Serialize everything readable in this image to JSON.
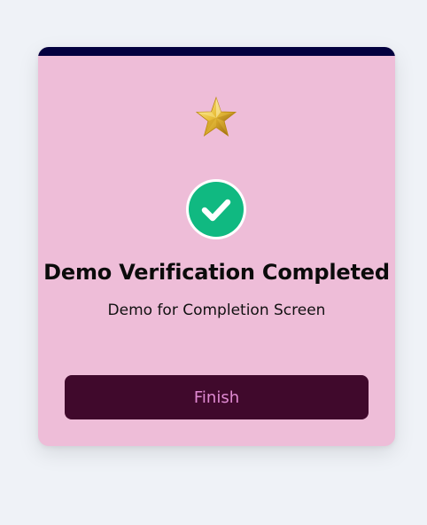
{
  "card": {
    "accent_bar_color": "#03013f",
    "background_color": "#eebdd8",
    "star_icon": "gold-star-icon",
    "status_icon": "check-circle-icon",
    "status_color": "#10b981",
    "title": "Demo Verification Completed",
    "subtitle": "Demo for Completion Screen",
    "finish_label": "Finish"
  }
}
